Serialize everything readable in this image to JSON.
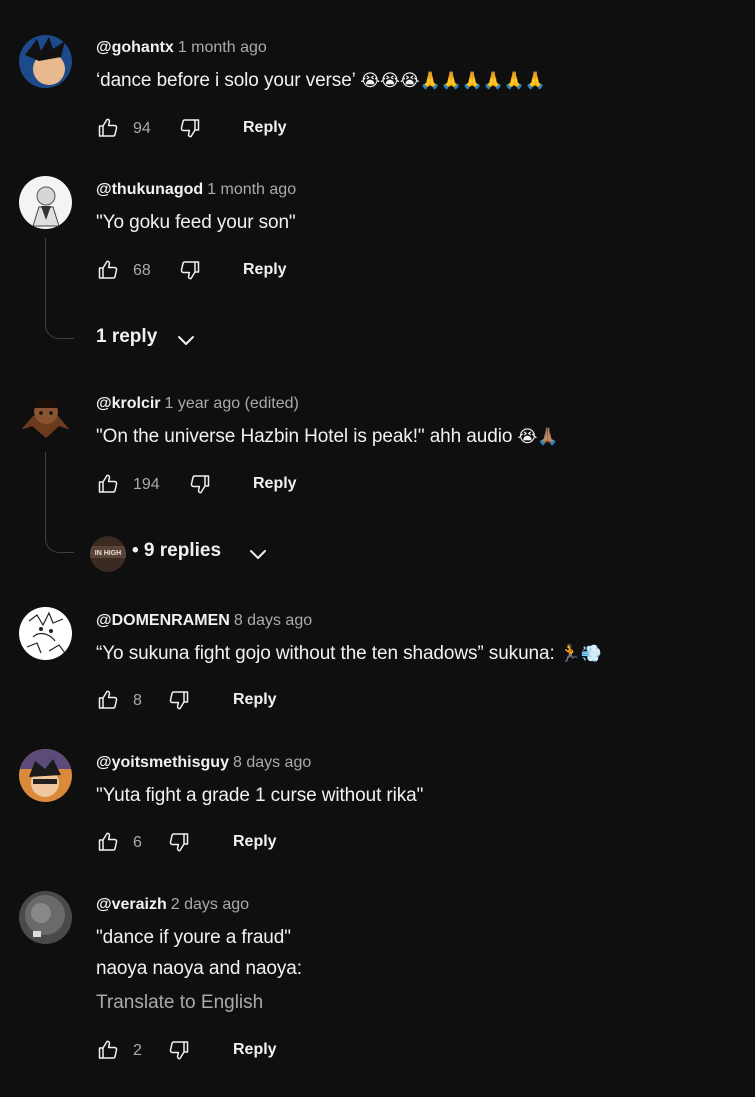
{
  "comments": [
    {
      "handle": "@gohantx",
      "time": "1 month ago",
      "text": "‘dance before i solo your verse’",
      "emoji": "😭😭😭🙏🙏🙏🙏🙏🙏",
      "likes": "94",
      "reply": "Reply"
    },
    {
      "handle": "@thukunagod",
      "time": "1 month ago",
      "text": "\"Yo goku feed your son\"",
      "likes": "68",
      "reply": "Reply",
      "replies": "1 reply"
    },
    {
      "handle": "@krolcir",
      "time": "1 year ago (edited)",
      "text": "\"On the universe Hazbin Hotel is peak!\" ahh audio",
      "emoji": "😭🙏🏽",
      "likes": "194",
      "reply": "Reply",
      "replies": "• 9 replies",
      "reply_avatar_text": "IN HIGH"
    },
    {
      "handle": "@DOMENRAMEN",
      "time": "8 days ago",
      "text": "“Yo sukuna fight gojo without the ten shadows” sukuna:",
      "emoji": "🏃💨",
      "likes": "8",
      "reply": "Reply"
    },
    {
      "handle": "@yoitsmethisguy",
      "time": "8 days ago",
      "text": "\"Yuta fight a grade 1 curse without rika\"",
      "likes": "6",
      "reply": "Reply"
    },
    {
      "handle": "@veraizh",
      "time": "2 days ago",
      "text": "\"dance if youre a fraud\"",
      "text2": "naoya naoya and naoya:",
      "translate": "Translate to English",
      "likes": "2",
      "reply": "Reply"
    }
  ],
  "icons": {
    "like": "thumbs-up-icon",
    "dislike": "thumbs-down-icon",
    "expand": "chevron-down-icon"
  },
  "colors": {
    "background": "#0f0f0f",
    "text": "#f1f1f1",
    "secondary": "#aaaaaa"
  }
}
